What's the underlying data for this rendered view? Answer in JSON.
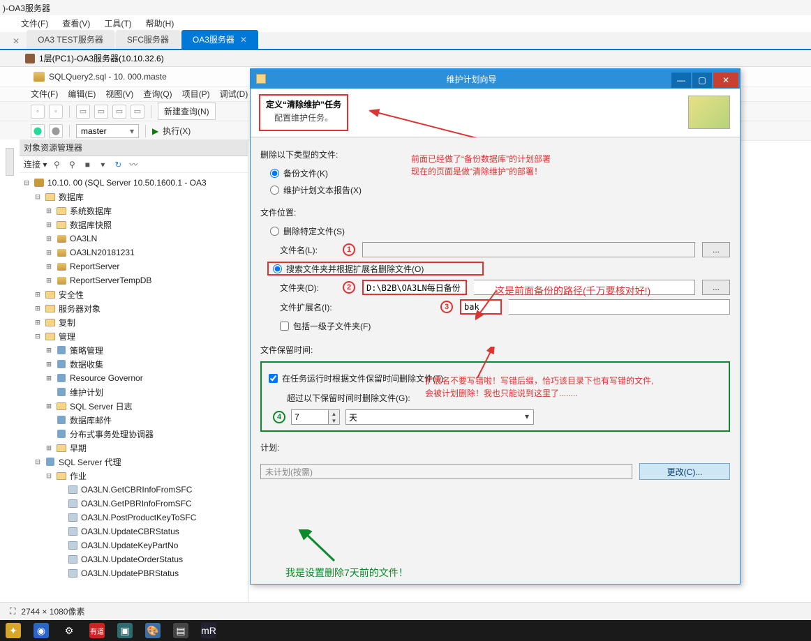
{
  "title_bar": ")-OA3服务器",
  "main_menu": {
    "file": "文件(F)",
    "view": "查看(V)",
    "tools": "工具(T)",
    "help": "帮助(H)"
  },
  "tabs": {
    "t1": "OA3 TEST服务器",
    "t2": "SFC服务器",
    "t3": "OA3服务器"
  },
  "breadcrumb": "1层(PC1)-OA3服务器(10.10.32.6)",
  "sql_title": "SQLQuery2.sql - 10.            000.maste",
  "sub_menu": {
    "m1": "文件(F)",
    "m2": "编辑(E)",
    "m3": "视图(V)",
    "m4": "查询(Q)",
    "m5": "项目(P)",
    "m6": "调试(D)"
  },
  "toolbar": {
    "new_query": "新建查询(N)",
    "master": "master",
    "exec": "执行(X)"
  },
  "objexp": {
    "title": "对象资源管理器",
    "connect": "连接 ▾",
    "root": "10.10.           00 (SQL Server 10.50.1600.1 - OA3",
    "db": "数据库",
    "sysdb": "系统数据库",
    "snap": "数据库快照",
    "l1": "OA3LN",
    "l2": "OA3LN20181231",
    "l3": "ReportServer",
    "l4": "ReportServerTempDB",
    "sec": "安全性",
    "svobj": "服务器对象",
    "repl": "复制",
    "mgmt": "管理",
    "policy": "策略管理",
    "datacol": "数据收集",
    "resgov": "Resource Governor",
    "maint": "维护计划",
    "logs": "SQL Server 日志",
    "dbmail": "数据库邮件",
    "dtc": "分布式事务处理协调器",
    "early": "早期",
    "agent": "SQL Server 代理",
    "jobs": "作业",
    "j1": "OA3LN.GetCBRInfoFromSFC",
    "j2": "OA3LN.GetPBRInfoFromSFC",
    "j3": "OA3LN.PostProductKeyToSFC",
    "j4": "OA3LN.UpdateCBRStatus",
    "j5": "OA3LN.UpdateKeyPartNo",
    "j6": "OA3LN.UpdateOrderStatus",
    "j7": "OA3LN.UpdatePBRStatus"
  },
  "dialog": {
    "title": "维护计划向导",
    "def_title": "定义“清除维护”任务",
    "def_sub": "配置维护任务。",
    "grp_delete": "删除以下类型的文件:",
    "r_backup": "备份文件(K)",
    "r_report": "维护计划文本报告(X)",
    "grp_loc": "文件位置:",
    "r_specific": "删除特定文件(S)",
    "lbl_filename": "文件名(L):",
    "r_search": "搜索文件夹并根据扩展名删除文件(O)",
    "lbl_folder": "文件夹(D):",
    "val_folder": "D:\\B2B\\OA3LN每日备份",
    "lbl_ext": "文件扩展名(I):",
    "val_ext": "bak",
    "chk_sub": "包括一级子文件夹(F)",
    "grp_retain": "文件保留时间:",
    "chk_retain": "在任务运行时根据文件保留时间删除文件(T)",
    "lbl_over": "超过以下保留时间时删除文件(G):",
    "val_num": "7",
    "val_unit": "天",
    "grp_plan": "计划:",
    "val_plan": "未计划(按需)",
    "btn_change": "更改(C)..."
  },
  "anno": {
    "r1": "前面已经做了“备份数据库”的计划部署",
    "r2": "现在的页面是做“清除维护”的部署！",
    "r3": "这是前面备份的路径(千万要核对好!)",
    "r4a": "扩展名不要写错啦！写错后缀，恰巧该目录下也有写错的文件,",
    "r4b": "会被计划删除！我也只能说到这里了........",
    "g1": "我是设置删除7天前的文件！"
  },
  "status": "2744 × 1080像素"
}
